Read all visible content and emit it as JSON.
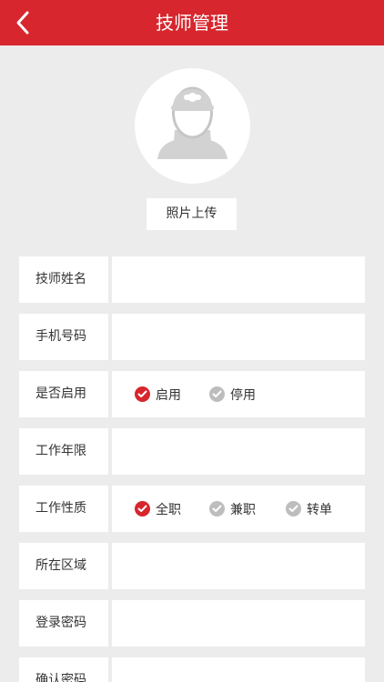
{
  "header": {
    "title": "技师管理",
    "back_icon": "chevron-left-icon"
  },
  "avatar": {
    "icon": "technician-avatar-icon",
    "upload_label": "照片上传"
  },
  "form": {
    "name": {
      "label": "技师姓名",
      "value": ""
    },
    "phone": {
      "label": "手机号码",
      "value": ""
    },
    "enabled": {
      "label": "是否启用",
      "options": [
        "启用",
        "停用"
      ],
      "selected": "启用"
    },
    "years": {
      "label": "工作年限",
      "value": ""
    },
    "job_type": {
      "label": "工作性质",
      "options": [
        "全职",
        "兼职",
        "转单"
      ],
      "selected": "全职"
    },
    "area": {
      "label": "所在区域",
      "value": ""
    },
    "password": {
      "label": "登录密码",
      "value": ""
    },
    "confirm_password": {
      "label": "确认密码",
      "value": ""
    }
  },
  "colors": {
    "accent": "#d7262d",
    "background": "#ececec",
    "radio_off": "#bdbdbd"
  }
}
